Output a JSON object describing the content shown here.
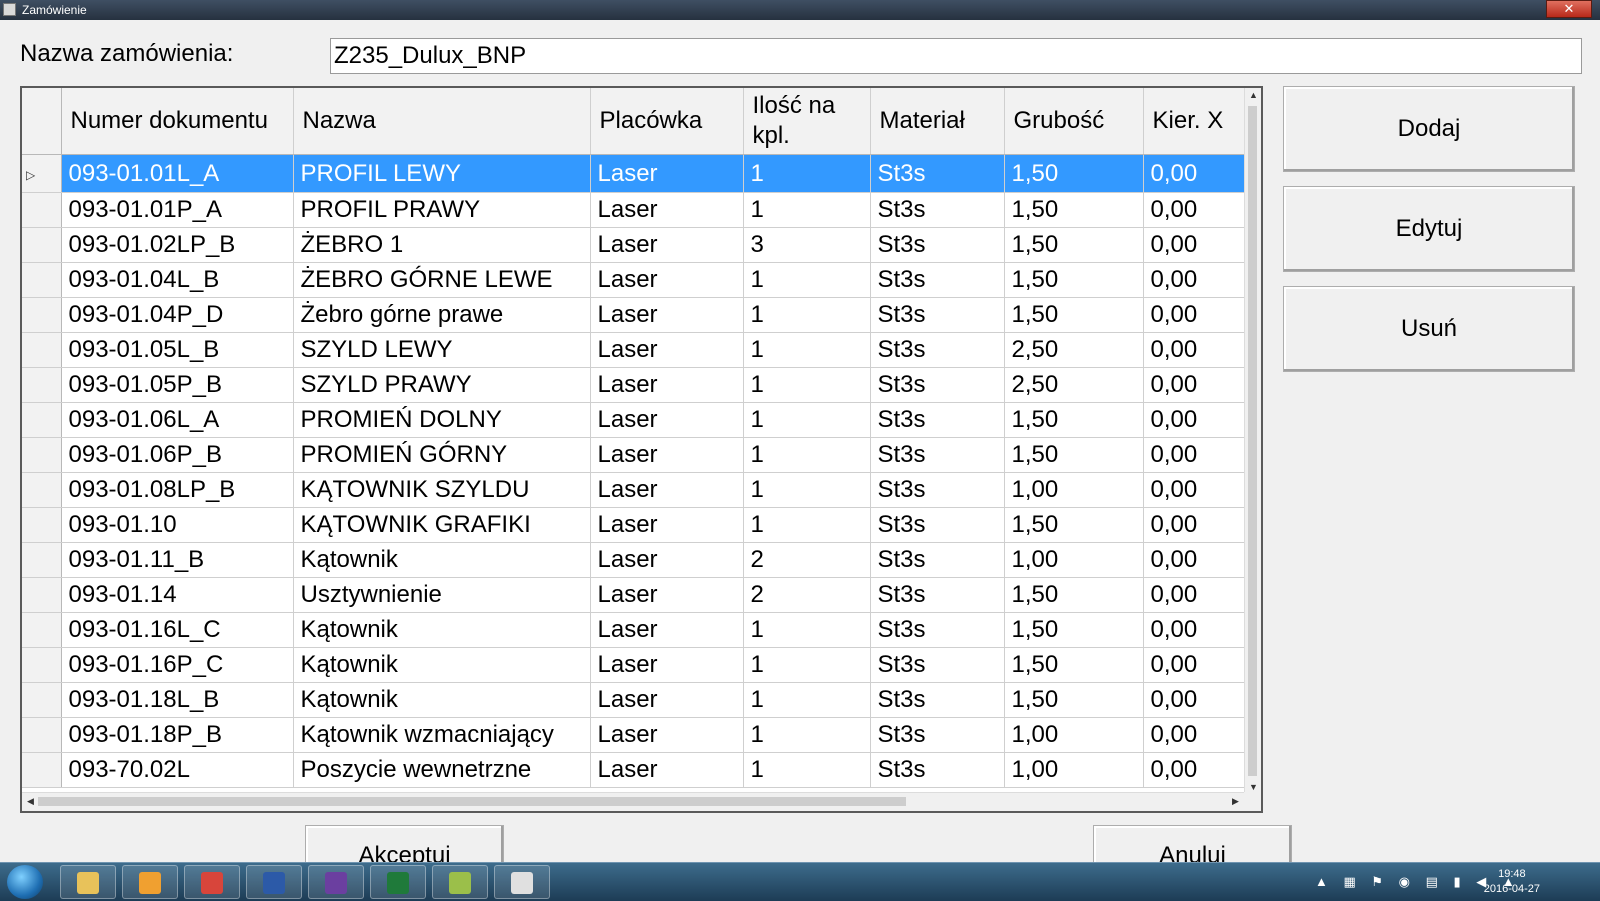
{
  "window": {
    "title": "Zamówienie",
    "close_label": "✕"
  },
  "order": {
    "label": "Nazwa zamówienia:",
    "value": "Z235_Dulux_BNP"
  },
  "grid": {
    "columns": [
      "Numer dokumentu",
      "Nazwa",
      "Placówka",
      "Ilość na kpl.",
      "Materiał",
      "Grubość",
      "Kier. X"
    ],
    "selected_row": 0,
    "rows": [
      [
        "093-01.01L_A",
        "PROFIL LEWY",
        "Laser",
        "1",
        "St3s",
        "1,50",
        "0,00"
      ],
      [
        "093-01.01P_A",
        "PROFIL PRAWY",
        "Laser",
        "1",
        "St3s",
        "1,50",
        "0,00"
      ],
      [
        "093-01.02LP_B",
        "ŻEBRO 1",
        "Laser",
        "3",
        "St3s",
        "1,50",
        "0,00"
      ],
      [
        "093-01.04L_B",
        "ŻEBRO GÓRNE LEWE",
        "Laser",
        "1",
        "St3s",
        "1,50",
        "0,00"
      ],
      [
        "093-01.04P_D",
        "Żebro górne prawe",
        "Laser",
        "1",
        "St3s",
        "1,50",
        "0,00"
      ],
      [
        "093-01.05L_B",
        "SZYLD LEWY",
        "Laser",
        "1",
        "St3s",
        "2,50",
        "0,00"
      ],
      [
        "093-01.05P_B",
        "SZYLD PRAWY",
        "Laser",
        "1",
        "St3s",
        "2,50",
        "0,00"
      ],
      [
        "093-01.06L_A",
        "PROMIEŃ DOLNY",
        "Laser",
        "1",
        "St3s",
        "1,50",
        "0,00"
      ],
      [
        "093-01.06P_B",
        "PROMIEŃ GÓRNY",
        "Laser",
        "1",
        "St3s",
        "1,50",
        "0,00"
      ],
      [
        "093-01.08LP_B",
        "KĄTOWNIK SZYLDU",
        "Laser",
        "1",
        "St3s",
        "1,00",
        "0,00"
      ],
      [
        "093-01.10",
        "KĄTOWNIK GRAFIKI",
        "Laser",
        "1",
        "St3s",
        "1,50",
        "0,00"
      ],
      [
        "093-01.11_B",
        "Kątownik",
        "Laser",
        "2",
        "St3s",
        "1,00",
        "0,00"
      ],
      [
        "093-01.14",
        "Usztywnienie",
        "Laser",
        "2",
        "St3s",
        "1,50",
        "0,00"
      ],
      [
        "093-01.16L_C",
        "Kątownik",
        "Laser",
        "1",
        "St3s",
        "1,50",
        "0,00"
      ],
      [
        "093-01.16P_C",
        "Kątownik",
        "Laser",
        "1",
        "St3s",
        "1,50",
        "0,00"
      ],
      [
        "093-01.18L_B",
        "Kątownik",
        "Laser",
        "1",
        "St3s",
        "1,50",
        "0,00"
      ],
      [
        "093-01.18P_B",
        "Kątownik wzmacniający",
        "Laser",
        "1",
        "St3s",
        "1,00",
        "0,00"
      ],
      [
        "093-70.02L",
        "Poszycie wewnetrzne",
        "Laser",
        "1",
        "St3s",
        "1,00",
        "0,00"
      ]
    ]
  },
  "buttons": {
    "add": "Dodaj",
    "edit": "Edytuj",
    "remove": "Usuń",
    "accept": "Akceptuj",
    "cancel": "Anuluj"
  },
  "taskbar": {
    "clock_time": "19:48",
    "clock_date": "2016-04-27",
    "apps": [
      {
        "name": "file-explorer-icon",
        "color": "#e8c25a"
      },
      {
        "name": "media-player-icon",
        "color": "#f0a030"
      },
      {
        "name": "chrome-icon",
        "color": "#d8453b"
      },
      {
        "name": "save-app-icon",
        "color": "#2c5aa8"
      },
      {
        "name": "visual-studio-icon",
        "color": "#6b3fa0"
      },
      {
        "name": "excel-icon",
        "color": "#1f7a3a"
      },
      {
        "name": "chart-app-icon",
        "color": "#9bbf4a"
      },
      {
        "name": "order-app-icon",
        "color": "#e0e0e0"
      }
    ]
  }
}
